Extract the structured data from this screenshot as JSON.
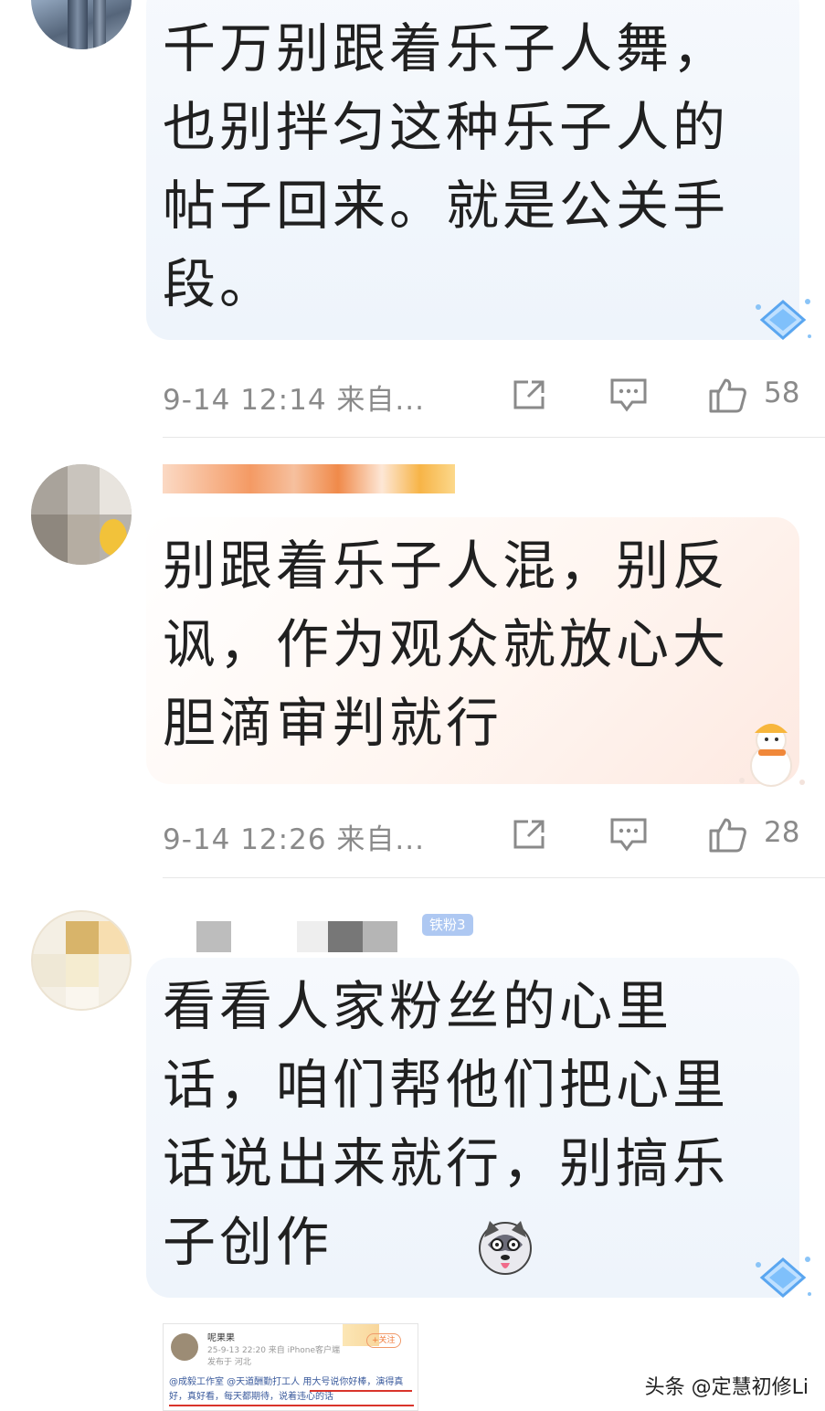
{
  "comments": [
    {
      "text": "千万别跟着乐子人舞，也别拌匀这种乐子人的帖子回来。就是公关手段。",
      "time": "9-14 12:14",
      "source": "来自...",
      "likes": "58"
    },
    {
      "text": "别跟着乐子人混，别反讽，作为观众就放心大胆滴审判就行",
      "time": "9-14 12:26",
      "source": "来自...",
      "likes": "28"
    },
    {
      "badge": "铁粉3",
      "text": "看看人家粉丝的心里话，咱们帮他们把心里话说出来就行，别搞乐子创作"
    }
  ],
  "embedded_post": {
    "name": "呢果果",
    "date": "25-9-13 22:20  来自 iPhone客户端",
    "location": "发布于 河北",
    "follow": "+关注",
    "body": "@成毅工作室 @天道酬勤打工人 用大号说你好棒，演得真好，真好看，每天都期待，说着违心的话"
  },
  "watermark": "头条 @定慧初修Li"
}
